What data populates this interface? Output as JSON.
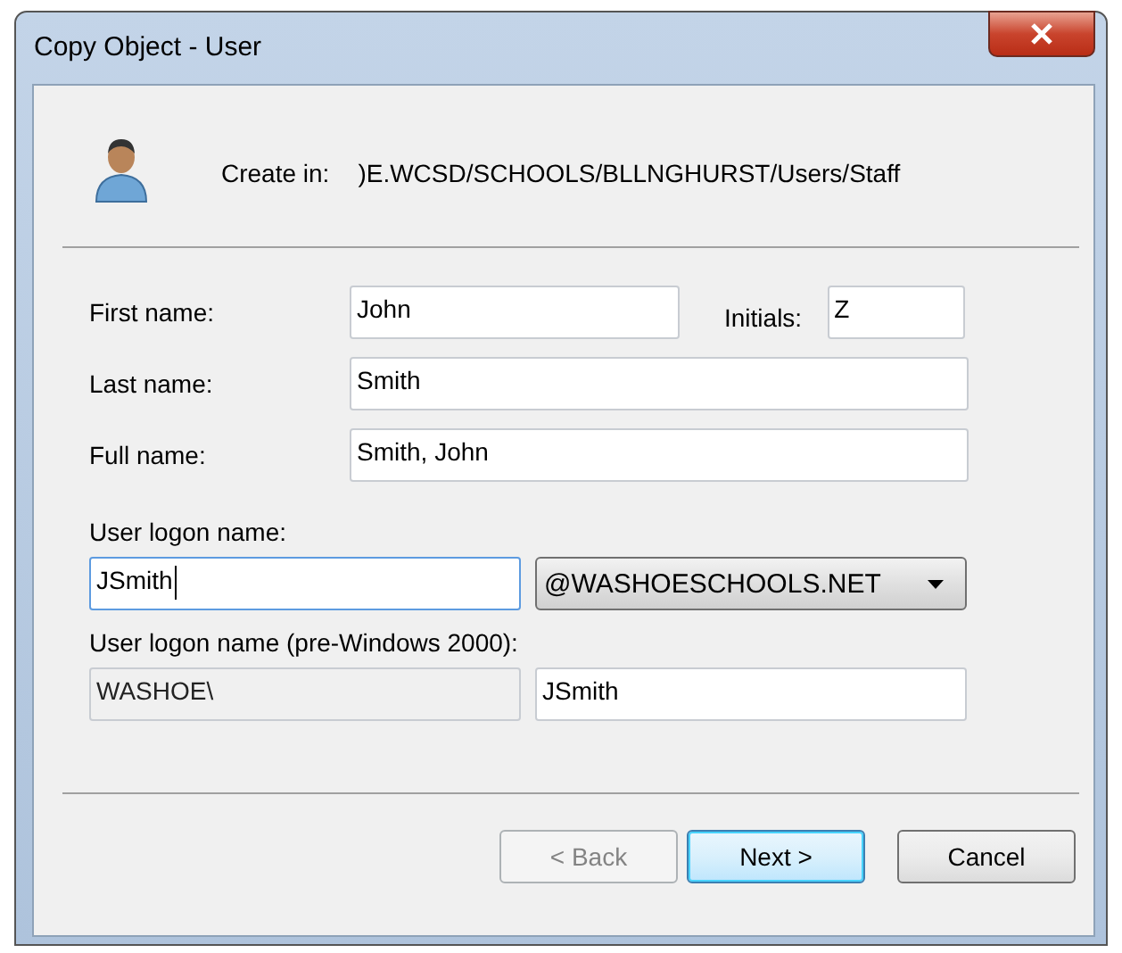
{
  "window": {
    "title": "Copy Object - User"
  },
  "create_in": {
    "label": "Create in:",
    "path": ")E.WCSD/SCHOOLS/BLLNGHURST/Users/Staff"
  },
  "name_fields": {
    "first_name": {
      "label": "First name:",
      "value": "John"
    },
    "initials": {
      "label": "Initials:",
      "value": "Z"
    },
    "last_name": {
      "label": "Last name:",
      "value": "Smith"
    },
    "full_name": {
      "label": "Full name:",
      "value": "Smith, John"
    }
  },
  "logon": {
    "label": "User logon name:",
    "value": "JSmith",
    "focused": true,
    "domain": "@WASHOESCHOOLS.NET"
  },
  "pre_windows": {
    "label": "User logon name (pre-Windows 2000):",
    "domain": "WASHOE\\",
    "domain_disabled": true,
    "value": "JSmith"
  },
  "buttons": [
    {
      "label": "< Back",
      "disabled": true,
      "default": false
    },
    {
      "label": "Next >",
      "disabled": false,
      "default": true
    },
    {
      "label": "Cancel",
      "disabled": false,
      "default": false
    }
  ]
}
